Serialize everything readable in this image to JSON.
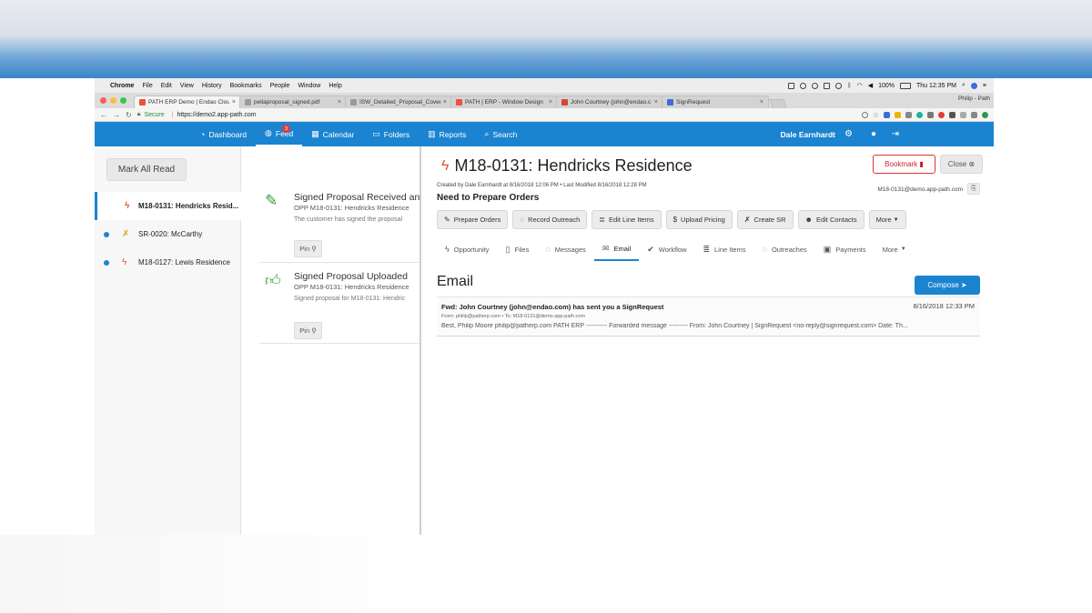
{
  "macbar": {
    "app": "Chrome",
    "menus": [
      "File",
      "Edit",
      "View",
      "History",
      "Bookmarks",
      "People",
      "Window",
      "Help"
    ],
    "battery": "100%",
    "clock": "Thu 12:35 PM"
  },
  "browser": {
    "tabs": [
      {
        "label": "PATH ERP Demo | Endao Cloud",
        "color": "#e8543a"
      },
      {
        "label": "pellaproposal_signed.pdf",
        "color": "#9a9a9a"
      },
      {
        "label": "ISW_Detailed_Proposal_Cover",
        "color": "#9a9a9a"
      },
      {
        "label": "PATH | ERP - Window Design",
        "color": "#e8543a"
      },
      {
        "label": "John Courtney (john@endao.c",
        "color": "#d44638"
      },
      {
        "label": "SignRequest",
        "color": "#3b6fd6"
      }
    ],
    "profile": "Philip - Path",
    "secure_label": "Secure",
    "url": "https://demo2.app-path.com"
  },
  "nav": {
    "items": [
      {
        "label": "Dashboard",
        "icon": "dashboard-icon",
        "glyph": "◔"
      },
      {
        "label": "Feed",
        "icon": "globe-icon",
        "glyph": "◍",
        "badge": "3"
      },
      {
        "label": "Calendar",
        "icon": "calendar-icon",
        "glyph": "▦"
      },
      {
        "label": "Folders",
        "icon": "folder-icon",
        "glyph": "▭"
      },
      {
        "label": "Reports",
        "icon": "bar-chart-icon",
        "glyph": "▥"
      },
      {
        "label": "Search",
        "icon": "search-icon",
        "glyph": "⌕"
      }
    ],
    "user": "Dale Earnhardt",
    "accent": "#1b84d0"
  },
  "sidebar": {
    "mark_all_read": "Mark All Read",
    "items": [
      {
        "label": "M18-0131: Hendricks Resid...",
        "icon": "bolt-icon",
        "unread": false
      },
      {
        "label": "SR-0020: McCarthy",
        "icon": "wrench-icon",
        "unread": true
      },
      {
        "label": "M18-0127: Lewis Residence",
        "icon": "bolt-icon",
        "unread": true
      }
    ]
  },
  "feed": {
    "cards": [
      {
        "title": "Signed Proposal Received and",
        "sub": "OPP M18-0131: Hendricks Residence",
        "desc": "The customer has signed the proposal",
        "icon": "edit-icon",
        "pin": "Pin"
      },
      {
        "title": "Signed Proposal Uploaded",
        "sub": "OPP M18-0131: Hendricks Residence",
        "desc": "Signed proposal for M18-0131: Hendric",
        "icon": "thumbs-up-icon",
        "pin": "Pin"
      }
    ]
  },
  "detail": {
    "title": "M18-0131: Hendricks Residence",
    "meta": "Created by Dale Earnhardt at 8/16/2018 12:06 PM • Last Modified 8/16/2018 12:28 PM",
    "status": "Need to Prepare Orders",
    "email_address": "M18-0131@demo.app-path.com",
    "bookmark": "Bookmark",
    "close": "Close",
    "actions": [
      {
        "label": "Prepare Orders",
        "glyph": "✎"
      },
      {
        "label": "Record Outreach",
        "glyph": "◌"
      },
      {
        "label": "Edit Line Items",
        "glyph": "≣"
      },
      {
        "label": "Upload Pricing",
        "glyph": "$"
      },
      {
        "label": "Create SR",
        "glyph": "✗"
      },
      {
        "label": "Edit Contacts",
        "glyph": "☻"
      },
      {
        "label": "More",
        "glyph": ""
      }
    ],
    "tabs": [
      {
        "label": "Opportunity",
        "glyph": "ϟ",
        "active": false
      },
      {
        "label": "Files",
        "glyph": "▯",
        "active": false
      },
      {
        "label": "Messages",
        "glyph": "◌",
        "active": false
      },
      {
        "label": "Email",
        "glyph": "✉",
        "active": true
      },
      {
        "label": "Workflow",
        "glyph": "✔",
        "active": false
      },
      {
        "label": "Line Items",
        "glyph": "≣",
        "active": false
      },
      {
        "label": "Outreaches",
        "glyph": "◌",
        "active": false
      },
      {
        "label": "Payments",
        "glyph": "▣",
        "active": false
      },
      {
        "label": "More",
        "glyph": "",
        "active": false
      }
    ],
    "section_title": "Email",
    "compose": "Compose",
    "email": {
      "subject": "Fwd: John Courtney (john@endao.com) has sent you a SignRequest",
      "date": "8/16/2018 12:33 PM",
      "from": "From: philip@patherp.com • To: M18-0131@demo.app-path.com",
      "body": "Best, Philip Moore philip@patherp.com PATH ERP ---------- Forwarded message --------- From: John Courtney | SignRequest <no-reply@signrequest.com> Date: Th..."
    }
  }
}
